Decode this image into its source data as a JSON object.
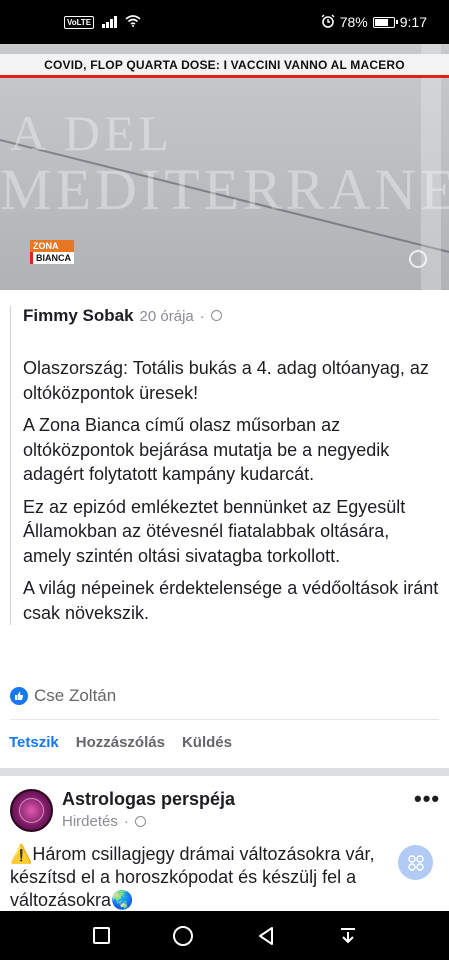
{
  "status_bar": {
    "volte": "VoLTE",
    "battery_percent": "78%",
    "time": "9:17",
    "battery_level": 0.78
  },
  "media": {
    "banner": "COVID, FLOP QUARTA DOSE: I VACCINI VANNO AL MACERO",
    "logo_line1": "ZONA",
    "logo_line2": "BIANCA",
    "wall_line1": "A DEL",
    "wall_line2": "MEDITERRANEO"
  },
  "shared_post": {
    "author": "Fimmy Sobak",
    "time": "20 órája",
    "dot": "·",
    "paragraphs": [
      "Olaszország: Totális bukás a 4. adag oltóanyag, az oltóközpontok üresek!",
      "A Zona Bianca című olasz műsorban az oltóközpontok bejárása mutatja be a negyedik adagért folytatott kampány kudarcát.",
      "Ez az epizód emlékeztet bennünket az Egyesült Államokban az ötévesnél fiatalabbak oltására, amely szintén oltási sivatagba torkollott.",
      "A világ népeinek érdektelensége a védőoltások iránt csak növekszik."
    ]
  },
  "reactions": {
    "reactor": "Cse Zoltán",
    "icon": "like-icon"
  },
  "actions": {
    "like": "Tetszik",
    "comment": "Hozzászólás",
    "send": "Küldés"
  },
  "ad": {
    "name": "Astrologas perspéja",
    "sub": "Hirdetés",
    "dot": "·",
    "text": "Három csillagjegy drámai változásokra vár, készítsd el a horoszkópodat és készülj fel a változásokra",
    "warn_icon": "⚠️",
    "globe_icon": "🌏",
    "more": "•••"
  },
  "colors": {
    "accent": "#1877f2",
    "muted": "#65676b",
    "banner_red": "#e2231a"
  }
}
